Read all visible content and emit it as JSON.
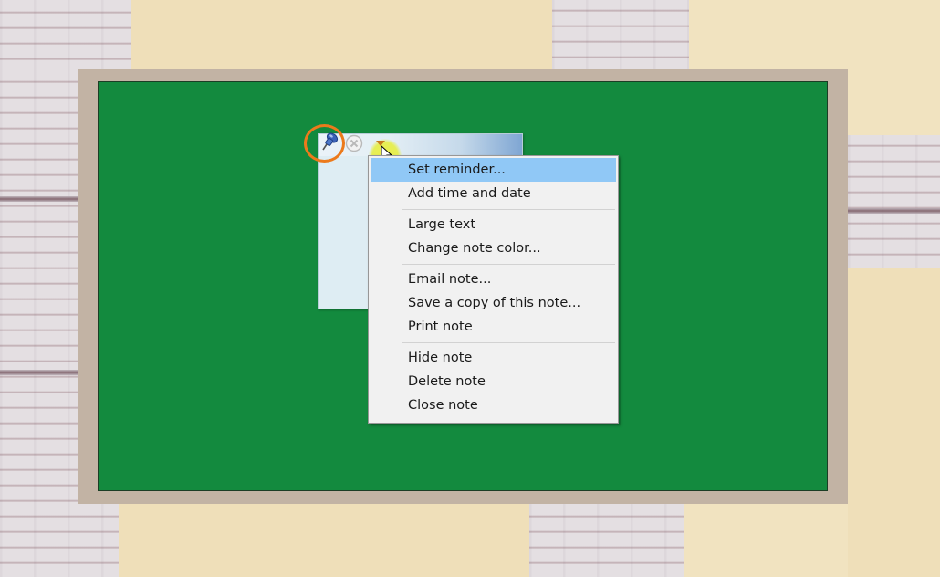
{
  "context_menu": {
    "groups": [
      {
        "items": [
          {
            "label": "Set reminder...",
            "active": true
          },
          {
            "label": "Add time and date"
          }
        ]
      },
      {
        "items": [
          {
            "label": "Large text"
          },
          {
            "label": "Change note color..."
          }
        ]
      },
      {
        "items": [
          {
            "label": "Email note..."
          },
          {
            "label": "Save a copy of this note..."
          },
          {
            "label": "Print note"
          }
        ]
      },
      {
        "items": [
          {
            "label": "Hide note"
          },
          {
            "label": "Delete note"
          },
          {
            "label": "Close note"
          }
        ]
      }
    ]
  },
  "note": {
    "icons": [
      "pin-icon",
      "close-icon",
      "menu-arrow-icon"
    ]
  },
  "colors": {
    "desktop": "#138a3e",
    "highlight_ring": "#ec7a1b",
    "menu_active": "#90c8f6",
    "cursor_halo": "#e6ee3c"
  }
}
